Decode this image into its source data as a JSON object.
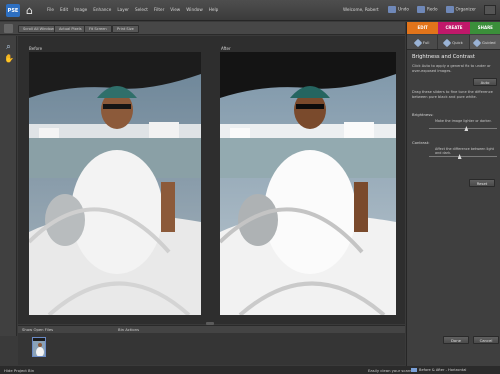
{
  "app": {
    "logo_text": "PSE",
    "menus": [
      "File",
      "Edit",
      "Image",
      "Enhance",
      "Layer",
      "Select",
      "Filter",
      "View",
      "Window",
      "Help"
    ],
    "welcome": "Welcome, Robert",
    "undo": "Undo",
    "redo": "Redo",
    "organizer": "Organizer"
  },
  "options": {
    "items": [
      "Scroll All Windows",
      "Actual Pixels",
      "Fit Screen",
      "Print Size"
    ]
  },
  "canvas": {
    "before_label": "Before",
    "after_label": "After"
  },
  "bin": {
    "show_label": "Show Open Files",
    "actions_label": "Bin Actions"
  },
  "status": {
    "hide_bin": "Hide Project Bin",
    "tip": "Easily clean your scans"
  },
  "panel": {
    "tabs": [
      {
        "label": "EDIT",
        "color": "#e2741a"
      },
      {
        "label": "CREATE",
        "color": "#c0186a"
      },
      {
        "label": "SHARE",
        "color": "#3b8f3a"
      }
    ],
    "subtabs": [
      "Full",
      "Quick",
      "Guided"
    ],
    "title": "Brightness and Contrast",
    "intro": "Click Auto to apply a general fix to under or over-exposed images.",
    "auto_button": "Auto",
    "drag_text": "Drag these sliders to fine tune the difference between pure black and pure white.",
    "brightness_label": "Brightness:",
    "brightness_hint": "Make the image lighter or darker.",
    "brightness_level": 0.55,
    "contrast_label": "Contrast:",
    "contrast_hint": "Affect the difference between light and dark.",
    "contrast_level": 0.45,
    "reset_button": "Reset",
    "done_button": "Done",
    "cancel_button": "Cancel",
    "view_label": "Before & After - Horizontal"
  }
}
